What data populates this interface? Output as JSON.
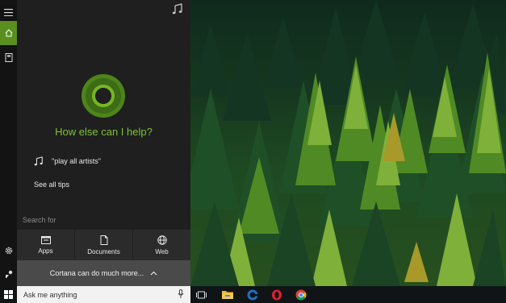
{
  "cortana": {
    "headline": "How else can I help?",
    "tip_text": "\"play all artists\"",
    "see_all_tips": "See all tips",
    "search_for_label": "Search for",
    "filters": [
      {
        "label": "Apps",
        "icon": "apps-icon"
      },
      {
        "label": "Documents",
        "icon": "document-icon"
      },
      {
        "label": "Web",
        "icon": "globe-icon"
      }
    ],
    "more_bar_label": "Cortana can do much more..."
  },
  "rail": {
    "items": [
      {
        "icon": "hamburger-menu-icon"
      },
      {
        "icon": "home-icon",
        "active": true
      },
      {
        "icon": "notebook-icon"
      },
      {
        "icon": "settings-icon"
      },
      {
        "icon": "feedback-icon"
      }
    ]
  },
  "taskbar": {
    "search_placeholder": "Ask me anything",
    "icons": [
      "windows-start-icon",
      "task-view-icon",
      "file-explorer-icon",
      "edge-browser-icon",
      "opera-browser-icon",
      "chrome-browser-icon"
    ]
  },
  "colors": {
    "accent": "#73b721",
    "headline": "#7bc235",
    "panel_bg": "#1f1f1f",
    "rail_bg": "#131313",
    "taskbar_bg": "#101417"
  }
}
